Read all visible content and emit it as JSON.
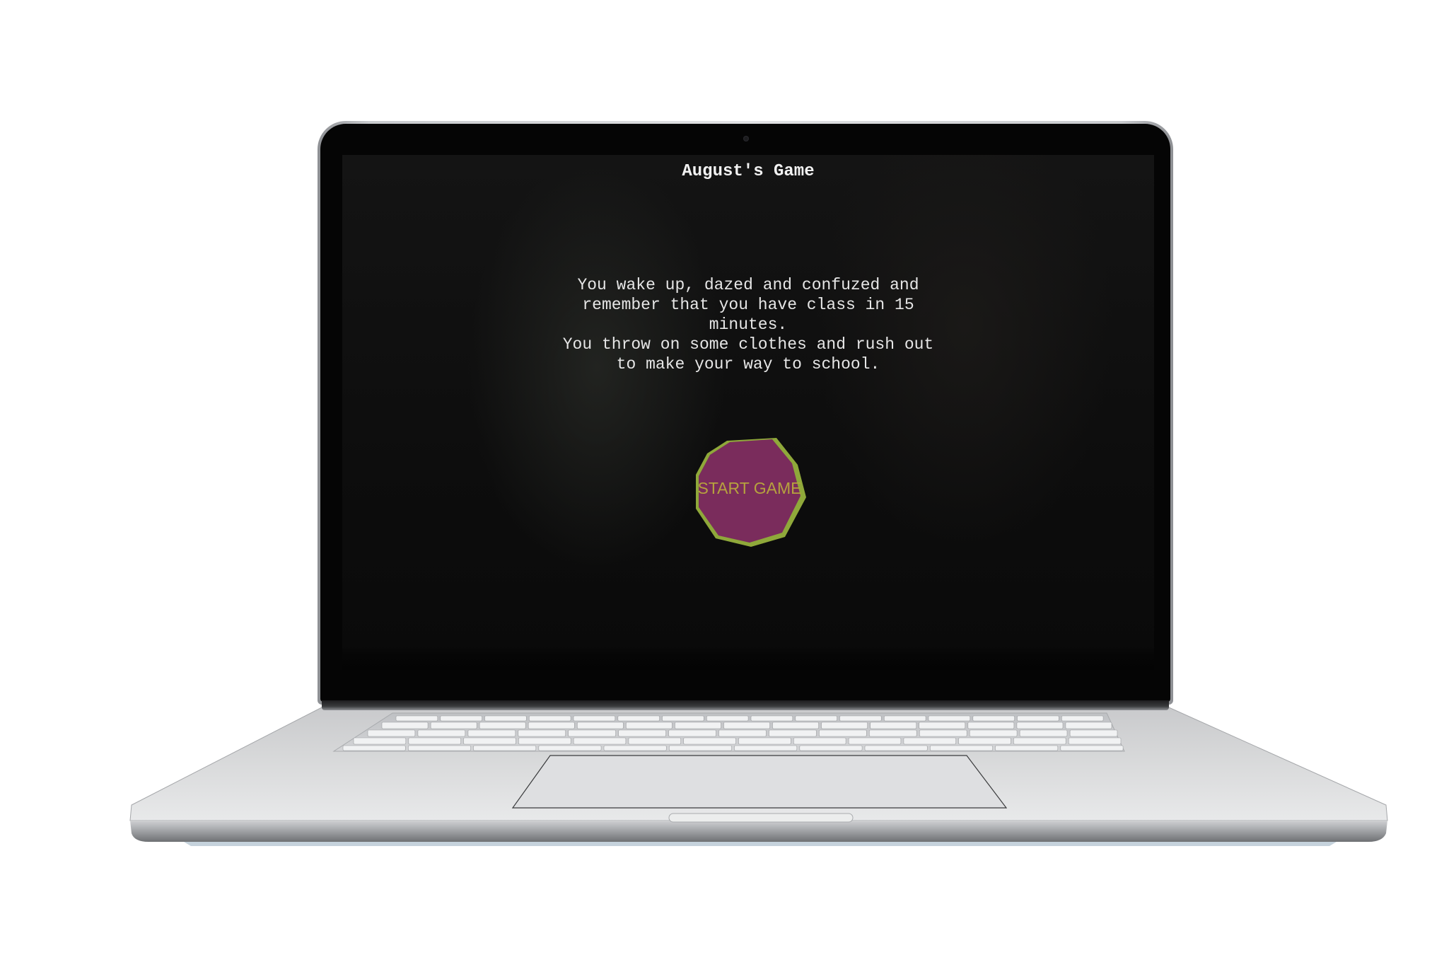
{
  "game": {
    "title": "August's Game",
    "story_lines": [
      "You wake up, dazed and confuzed and",
      "remember that you have class in 15",
      "minutes.",
      "You throw on some clothes and rush out",
      "to make your way to school."
    ],
    "start_button_label": "START GAME"
  },
  "colors": {
    "screen_background": "#0d0d0d",
    "title_text": "#f2f2f2",
    "story_text": "#e6e6e6",
    "start_button_fill": "#7a2c5c",
    "start_button_edge": "#8fa83a",
    "start_button_text": "#b6a23e",
    "laptop_body": "#d7d8da"
  },
  "icons": {
    "camera": "camera-icon"
  }
}
